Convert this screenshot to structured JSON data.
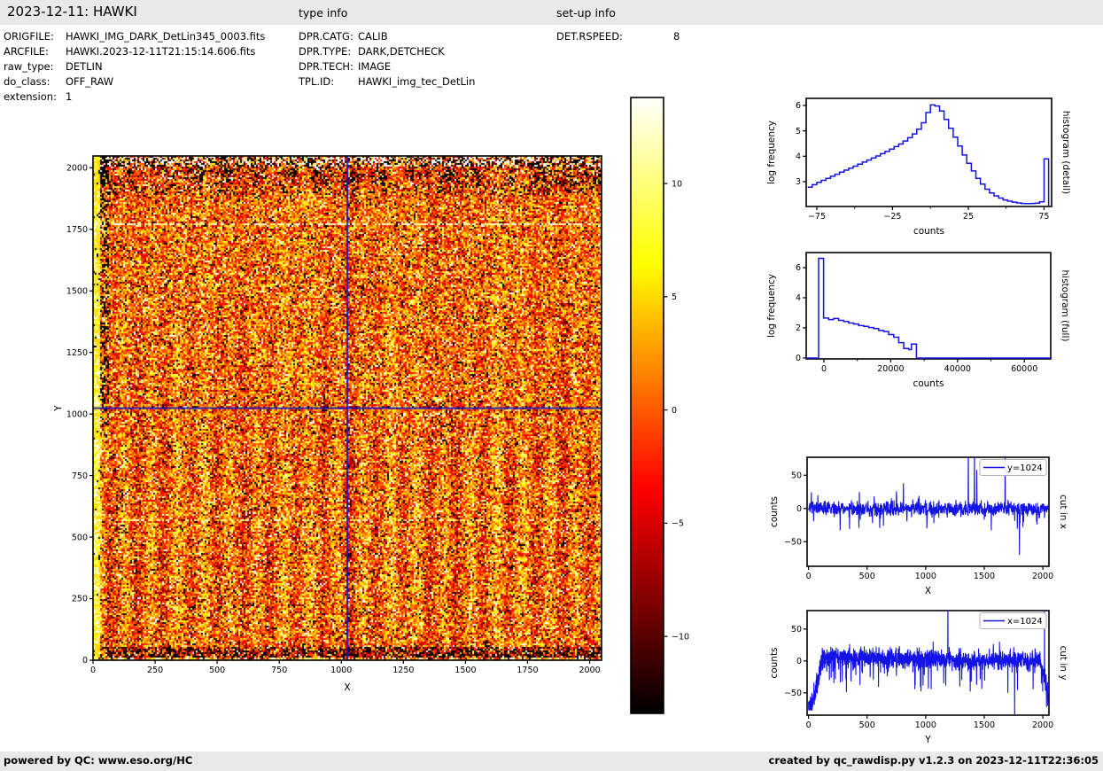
{
  "header": {
    "title": "2023-12-11: HAWKI",
    "type_info_label": "type info",
    "setup_info_label": "set-up info"
  },
  "metadata": {
    "file_info": [
      {
        "label": "ORIGFILE:",
        "value": "HAWKI_IMG_DARK_DetLin345_0003.fits"
      },
      {
        "label": "ARCFILE:",
        "value": "HAWKI.2023-12-11T21:15:14.606.fits"
      },
      {
        "label": "raw_type:",
        "value": "DETLIN"
      },
      {
        "label": "do_class:",
        "value": "OFF_RAW"
      },
      {
        "label": "extension:",
        "value": "1"
      }
    ],
    "type_info": [
      {
        "label": "DPR.CATG:",
        "value": "CALIB"
      },
      {
        "label": "DPR.TYPE:",
        "value": "DARK,DETCHECK"
      },
      {
        "label": "DPR.TECH:",
        "value": "IMAGE"
      },
      {
        "label": "TPL.ID:",
        "value": "HAWKI_img_tec_DetLin"
      }
    ],
    "setup_info": [
      {
        "label": "DET.RSPEED:",
        "value": "8"
      }
    ]
  },
  "footer": {
    "left": "powered by QC: www.eso.org/HC",
    "right": "created by qc_rawdisp.py v1.2.3 on 2023-12-11T22:36:05"
  },
  "colors": {
    "bar_bg": "#e9e9e9",
    "line_blue": "#1313e8",
    "crosshair_blue": "#0a0ad0",
    "axis": "#000000"
  },
  "chart_data": [
    {
      "type": "heatmap",
      "name": "raw-image",
      "xlabel": "X",
      "ylabel": "Y",
      "xlim": [
        0,
        2048
      ],
      "ylim": [
        0,
        2048
      ],
      "xticks_major": [
        0,
        250,
        500,
        750,
        1000,
        1250,
        1500,
        1750,
        2000
      ],
      "xtick_labels": [
        "0",
        "250",
        "500",
        "750",
        "1000",
        "1250",
        "1500",
        "1750",
        "2000"
      ],
      "yticks": [
        0,
        250,
        500,
        750,
        1000,
        1250,
        1500,
        1750,
        2000
      ],
      "ytick_labels": [
        "0",
        "250",
        "500",
        "750",
        "1000",
        "1250",
        "1500",
        "1750",
        "2000"
      ],
      "colormap": "hot",
      "colorbar": {
        "vmin": -13.4,
        "vmax": 13.8,
        "tick_values": [
          10,
          5,
          0,
          -5,
          -10
        ],
        "tick_labels": [
          "10",
          "5",
          "0",
          "−5",
          "−10"
        ]
      },
      "crosshair": {
        "x": 1024,
        "y": 1024
      },
      "noise": {
        "seed": 42,
        "sigma": 4.6,
        "mean": 0.8,
        "pepper": 0.055,
        "salt": 0.045,
        "stripe_period": 107,
        "features": {
          "top_saltpepper_band": [
            2012,
            2048
          ],
          "top_dark_band": [
            1935,
            2012
          ],
          "upper_dark_band": [
            1895,
            1935
          ],
          "bottom_dark_band": [
            12,
            55
          ],
          "left_bright_cols": [
            0,
            28
          ],
          "left_dark_strip": [
            28,
            62
          ],
          "white_rows": [
            1775,
            575
          ]
        }
      }
    },
    {
      "type": "line",
      "name": "histogram-detail",
      "side_label": "histogram (detail)",
      "xlabel": "counts",
      "ylabel": "log frequency",
      "xlim": [
        -82,
        80
      ],
      "ylim": [
        2.02,
        6.28
      ],
      "xticks_major": [
        -75,
        -25,
        25,
        75
      ],
      "xtick_labels": [
        "−75",
        "−25",
        "25",
        "75"
      ],
      "xticks_minor": [
        -50,
        0,
        50
      ],
      "yticks": [
        3,
        4,
        5,
        6
      ],
      "ytick_labels": [
        "3",
        "4",
        "5",
        "6"
      ],
      "hist": {
        "x0": -81,
        "dx": 3,
        "values": [
          2.78,
          2.88,
          2.97,
          3.05,
          3.13,
          3.21,
          3.29,
          3.37,
          3.45,
          3.53,
          3.61,
          3.69,
          3.77,
          3.85,
          3.93,
          4.01,
          4.1,
          4.19,
          4.28,
          4.38,
          4.48,
          4.6,
          4.73,
          4.88,
          5.07,
          5.32,
          5.72,
          6.02,
          5.98,
          5.78,
          5.45,
          5.1,
          4.75,
          4.4,
          4.05,
          3.72,
          3.42,
          3.13,
          2.9,
          2.7,
          2.55,
          2.44,
          2.35,
          2.28,
          2.23,
          2.19,
          2.16,
          2.14,
          2.13,
          2.14,
          2.15,
          2.2,
          3.9
        ]
      }
    },
    {
      "type": "line",
      "name": "histogram-full",
      "side_label": "histogram (full)",
      "xlabel": "counts",
      "ylabel": "log frequency",
      "xlim": [
        -5300,
        67900
      ],
      "ylim": [
        -0.06,
        7.0
      ],
      "xticks_major": [
        0,
        20000,
        40000,
        60000
      ],
      "xtick_labels": [
        "0",
        "20000",
        "40000",
        "60000"
      ],
      "xticks_minor": [
        10000,
        30000,
        50000
      ],
      "yticks": [
        0,
        2,
        4,
        6
      ],
      "ytick_labels": [
        "0",
        "2",
        "4",
        "6"
      ],
      "steps": [
        [
          -5300,
          0
        ],
        [
          -1600,
          0
        ],
        [
          -1600,
          6.62
        ],
        [
          -100,
          6.62
        ],
        [
          -100,
          2.65
        ],
        [
          1400,
          2.65
        ],
        [
          1400,
          2.55
        ],
        [
          2900,
          2.55
        ],
        [
          2900,
          2.62
        ],
        [
          4400,
          2.62
        ],
        [
          4400,
          2.5
        ],
        [
          5900,
          2.5
        ],
        [
          5900,
          2.42
        ],
        [
          7400,
          2.42
        ],
        [
          7400,
          2.32
        ],
        [
          8900,
          2.32
        ],
        [
          8900,
          2.26
        ],
        [
          10400,
          2.26
        ],
        [
          10400,
          2.15
        ],
        [
          11900,
          2.15
        ],
        [
          11900,
          2.1
        ],
        [
          13400,
          2.1
        ],
        [
          13400,
          2.02
        ],
        [
          14900,
          2.02
        ],
        [
          14900,
          1.95
        ],
        [
          16400,
          1.95
        ],
        [
          16400,
          1.83
        ],
        [
          17900,
          1.83
        ],
        [
          17900,
          1.76
        ],
        [
          19400,
          1.76
        ],
        [
          19400,
          1.56
        ],
        [
          20900,
          1.56
        ],
        [
          20900,
          1.38
        ],
        [
          22400,
          1.38
        ],
        [
          22400,
          1.02
        ],
        [
          23900,
          1.02
        ],
        [
          23900,
          0.63
        ],
        [
          25400,
          0.63
        ],
        [
          25400,
          0.56
        ],
        [
          26200,
          0.56
        ],
        [
          26200,
          0.92
        ],
        [
          27700,
          0.92
        ],
        [
          27700,
          0
        ],
        [
          67900,
          0
        ]
      ]
    },
    {
      "type": "line",
      "name": "cut-in-x",
      "side_label": "cut in x",
      "legend": "y=1024",
      "xlabel": "X",
      "ylabel": "counts",
      "xlim": [
        -12,
        2052
      ],
      "ylim": [
        -87,
        77
      ],
      "xticks_major": [
        0,
        500,
        1000,
        1500,
        2000
      ],
      "xtick_labels": [
        "0",
        "500",
        "1000",
        "1500",
        "2000"
      ],
      "yticks": [
        -50,
        0,
        50
      ],
      "ytick_labels": [
        "−50",
        "0",
        "50"
      ],
      "noise": {
        "seed": 7,
        "sigma": 5.5,
        "n": 1024,
        "step": 2
      },
      "spikes": [
        [
          270,
          -33
        ],
        [
          350,
          -31
        ],
        [
          430,
          -29
        ],
        [
          560,
          18
        ],
        [
          640,
          -26
        ],
        [
          750,
          26
        ],
        [
          810,
          38
        ],
        [
          935,
          15
        ],
        [
          1010,
          -30
        ],
        [
          1070,
          -22
        ],
        [
          1363,
          95
        ],
        [
          1416,
          95
        ],
        [
          1435,
          58
        ],
        [
          1560,
          -33
        ],
        [
          1678,
          95
        ],
        [
          1800,
          -70
        ],
        [
          1830,
          -28
        ],
        [
          1950,
          -24
        ]
      ]
    },
    {
      "type": "line",
      "name": "cut-in-y",
      "side_label": "cut in y",
      "legend": "x=1024",
      "xlabel": "Y",
      "ylabel": "counts",
      "xlim": [
        -12,
        2052
      ],
      "ylim": [
        -85,
        79
      ],
      "xticks_major": [
        0,
        500,
        1000,
        1500,
        2000
      ],
      "xtick_labels": [
        "0",
        "500",
        "1000",
        "1500",
        "2000"
      ],
      "yticks": [
        -50,
        0,
        50
      ],
      "ytick_labels": [
        "−50",
        "0",
        "50"
      ],
      "noise": {
        "seed": 11,
        "sigma": 7.5,
        "n": 1366,
        "step": 1.5,
        "down_spike_p": 0.05,
        "down_spike_amp": 40,
        "start_dip_until": 110,
        "start_dip_depth": -62,
        "end_dip_from": 1975,
        "end_dip_depth": -52,
        "early_mean": 6
      },
      "spikes": [
        [
          1190,
          95
        ],
        [
          1630,
          30
        ],
        [
          1760,
          -95
        ],
        [
          2015,
          86
        ],
        [
          2042,
          -70
        ]
      ]
    }
  ]
}
